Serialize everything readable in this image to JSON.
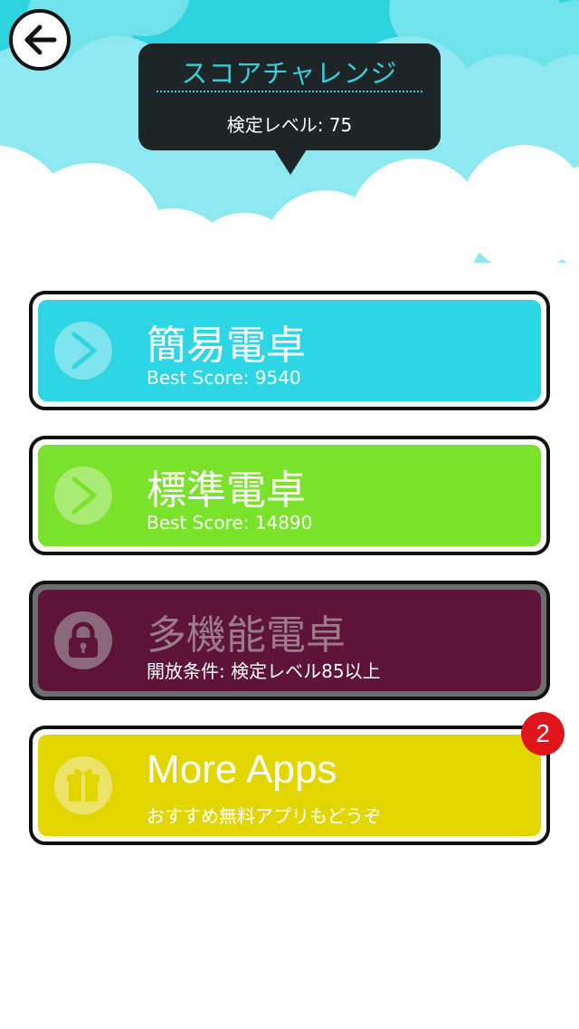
{
  "header": {
    "title": "スコアチャレンジ",
    "level_text": "検定レベル: 75"
  },
  "cards": [
    {
      "title": "簡易電卓",
      "subtitle": "Best Score: 9540",
      "icon": "play-arrow-icon",
      "color": "#2ed6e3",
      "locked": false
    },
    {
      "title": "標準電卓",
      "subtitle": "Best Score: 14890",
      "icon": "play-arrow-icon",
      "color": "#7be22c",
      "locked": false
    },
    {
      "title": "多機能電卓",
      "subtitle": "開放条件: 検定レベル85以上",
      "icon": "lock-icon",
      "color": "#5e1438",
      "locked": true
    },
    {
      "title": "More Apps",
      "subtitle": "おすすめ無料アプリもどうぞ",
      "icon": "gift-icon",
      "color": "#e1d600",
      "locked": false
    }
  ],
  "badge": {
    "count": "2",
    "color": "#e0141b"
  },
  "colors": {
    "sky": "#2ed3e0",
    "cloud_light": "#8ee8ef",
    "tooltip_bg": "#1e2526",
    "tooltip_accent": "#37cfe0"
  }
}
